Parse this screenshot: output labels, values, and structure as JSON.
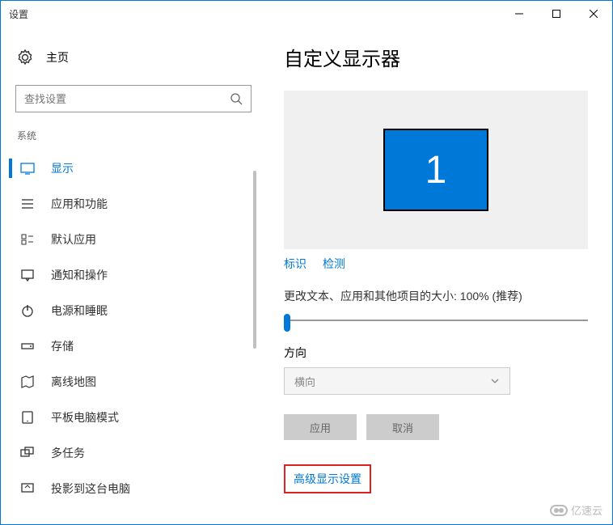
{
  "window": {
    "title": "设置"
  },
  "sidebar": {
    "home_label": "主页",
    "search_placeholder": "查找设置",
    "category": "系统",
    "items": [
      {
        "label": "显示",
        "icon": "monitor-icon",
        "active": true
      },
      {
        "label": "应用和功能",
        "icon": "apps-icon",
        "active": false
      },
      {
        "label": "默认应用",
        "icon": "defaults-icon",
        "active": false
      },
      {
        "label": "通知和操作",
        "icon": "notifications-icon",
        "active": false
      },
      {
        "label": "电源和睡眠",
        "icon": "power-icon",
        "active": false
      },
      {
        "label": "存储",
        "icon": "storage-icon",
        "active": false
      },
      {
        "label": "离线地图",
        "icon": "maps-icon",
        "active": false
      },
      {
        "label": "平板电脑模式",
        "icon": "tablet-icon",
        "active": false
      },
      {
        "label": "多任务",
        "icon": "multitask-icon",
        "active": false
      },
      {
        "label": "投影到这台电脑",
        "icon": "project-icon",
        "active": false
      }
    ]
  },
  "main": {
    "title": "自定义显示器",
    "monitor_number": "1",
    "identify_link": "标识",
    "detect_link": "检测",
    "scale_label": "更改文本、应用和其他项目的大小: 100% (推荐)",
    "orientation_label": "方向",
    "orientation_value": "横向",
    "apply_button": "应用",
    "cancel_button": "取消",
    "advanced_link": "高级显示设置"
  },
  "watermark": "亿速云"
}
